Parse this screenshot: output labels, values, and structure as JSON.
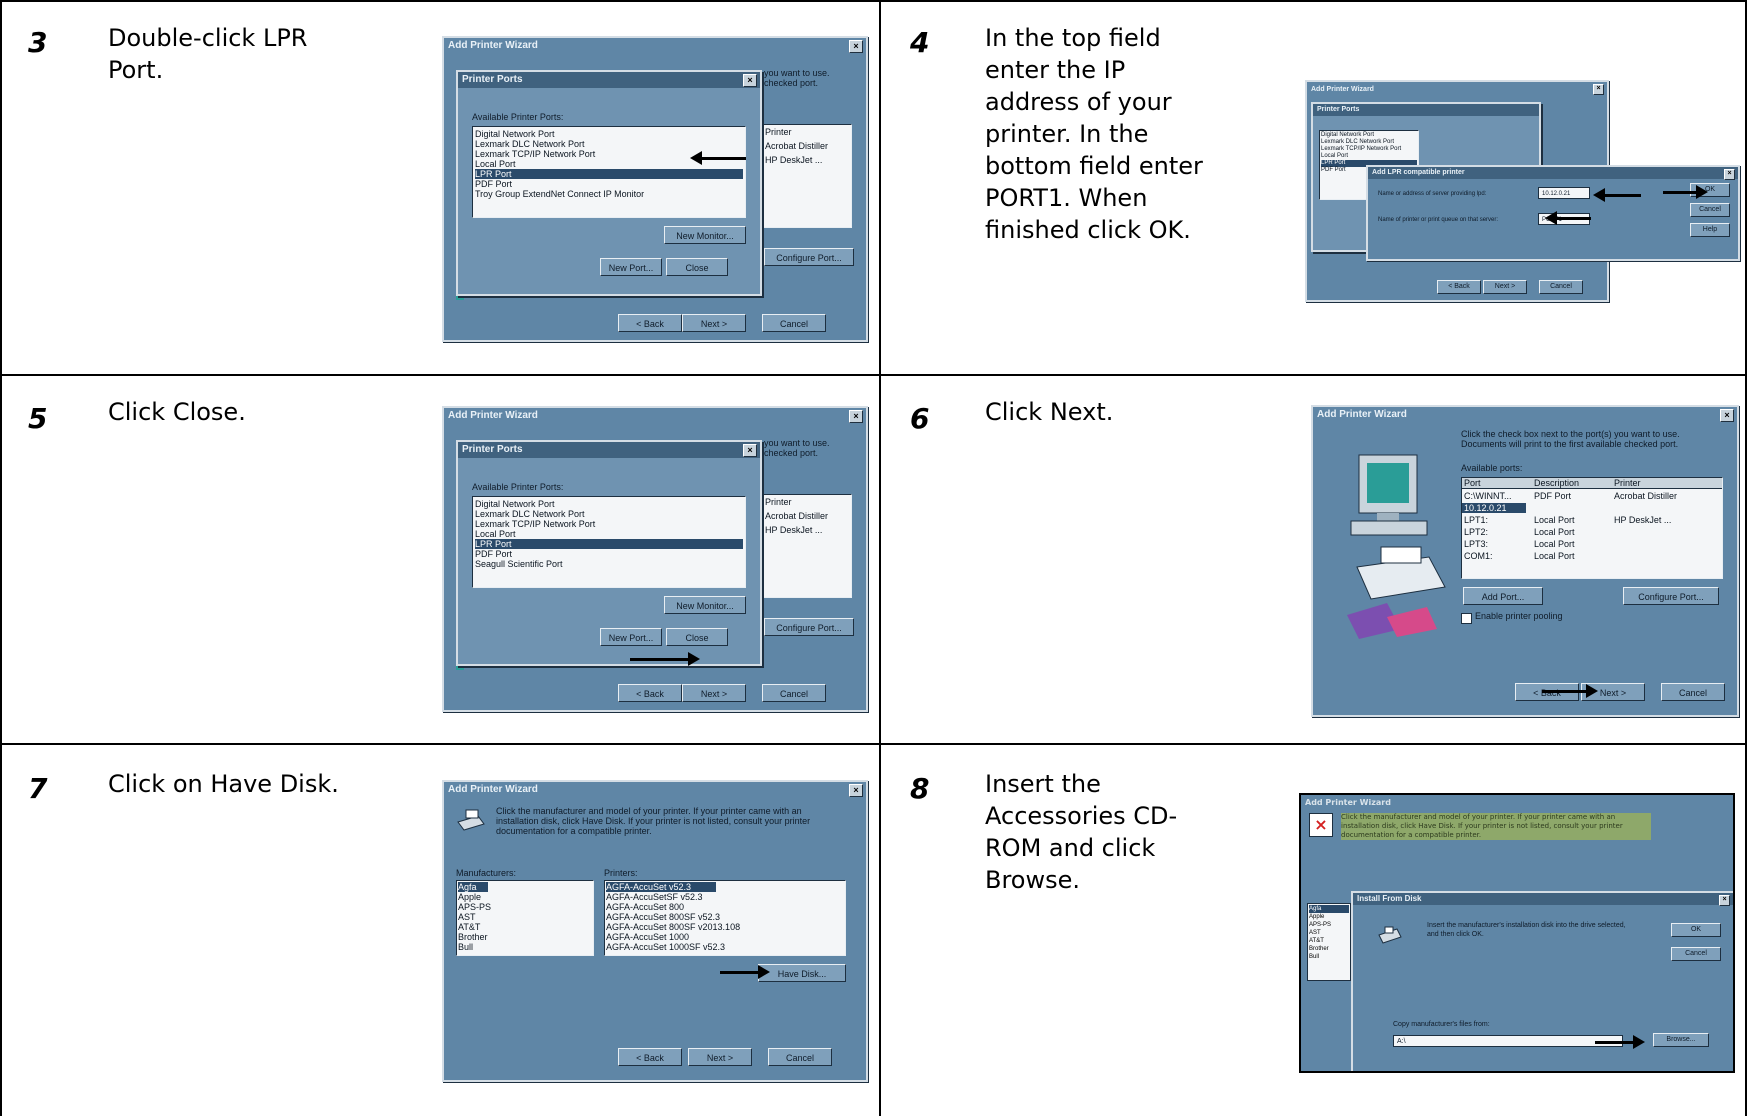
{
  "steps": [
    {
      "num": "3",
      "text": "Double-click LPR Port."
    },
    {
      "num": "4",
      "text": "In the top field enter the IP address of your printer. In the bottom field enter PORT1. When finished click OK."
    },
    {
      "num": "5",
      "text": "Click Close."
    },
    {
      "num": "6",
      "text": "Click Next."
    },
    {
      "num": "7",
      "text": "Click on Have Disk."
    },
    {
      "num": "8",
      "text": "Insert the Accessories CD-ROM and click Browse."
    }
  ],
  "wizard_title": "Add Printer Wizard",
  "printer_ports": {
    "title": "Printer Ports",
    "label": "Available Printer Ports:",
    "ports_a": [
      "Digital Network Port",
      "Lexmark DLC Network Port",
      "Lexmark TCP/IP Network Port",
      "Local Port",
      "LPR Port",
      "PDF Port",
      "Troy Group ExtendNet Connect IP Monitor"
    ],
    "ports_b": [
      "Digital Network Port",
      "Lexmark DLC Network Port",
      "Lexmark TCP/IP Network Port",
      "Local Port",
      "LPR Port",
      "PDF Port",
      "Seagull Scientific Port"
    ],
    "new_monitor": "New Monitor...",
    "new_port": "New Port...",
    "close": "Close",
    "configure_port": "Configure Port...",
    "behind_text": "you want to use. checked port.",
    "behind_printer": "Printer",
    "behind_items": [
      "Acrobat Distiller",
      "HP DeskJet ..."
    ]
  },
  "nav": {
    "back": "< Back",
    "next": "Next >",
    "cancel": "Cancel"
  },
  "lpr": {
    "title": "Add LPR compatible printer",
    "field1_label": "Name or address of server providing lpd:",
    "field1_value": "10.12.0.21",
    "field2_label": "Name of printer or print queue on that server:",
    "field2_value": "PORT1",
    "ok": "OK",
    "cancel": "Cancel",
    "help": "Help"
  },
  "ports_page": {
    "intro": "Click the check box next to the port(s) you want to use. Documents will print to the first available checked port.",
    "label": "Available ports:",
    "columns": [
      "Port",
      "Description",
      "Printer"
    ],
    "rows": [
      [
        "C:\\WINNT...",
        "PDF Port",
        "Acrobat Distiller"
      ],
      [
        "10.12.0.21",
        "",
        ""
      ],
      [
        "LPT1:",
        "Local Port",
        "HP DeskJet ..."
      ],
      [
        "LPT2:",
        "Local Port",
        ""
      ],
      [
        "LPT3:",
        "Local Port",
        ""
      ],
      [
        "COM1:",
        "Local Port",
        ""
      ]
    ],
    "add_port": "Add Port...",
    "configure_port": "Configure Port...",
    "pooling": "Enable printer pooling"
  },
  "mfr_page": {
    "intro": "Click the manufacturer and model of your printer. If your printer came with an installation disk, click Have Disk. If your printer is not listed, consult your printer documentation for a compatible printer.",
    "mfr_label": "Manufacturers:",
    "printers_label": "Printers:",
    "manufacturers": [
      "Agfa",
      "Apple",
      "APS-PS",
      "AST",
      "AT&T",
      "Brother",
      "Bull"
    ],
    "printers": [
      "AGFA-AccuSet v52.3",
      "AGFA-AccuSetSF v52.3",
      "AGFA-AccuSet 800",
      "AGFA-AccuSet 800SF v52.3",
      "AGFA-AccuSet 800SF v2013.108",
      "AGFA-AccuSet 1000",
      "AGFA-AccuSet 1000SF v52.3"
    ],
    "have_disk": "Have Disk..."
  },
  "disk": {
    "title": "Install From Disk",
    "message": "Insert the manufacturer's installation disk into the drive selected, and then click OK.",
    "copy_label": "Copy manufacturer's files from:",
    "copy_value": "A:\\",
    "ok": "OK",
    "cancel": "Cancel",
    "browse": "Browse..."
  }
}
